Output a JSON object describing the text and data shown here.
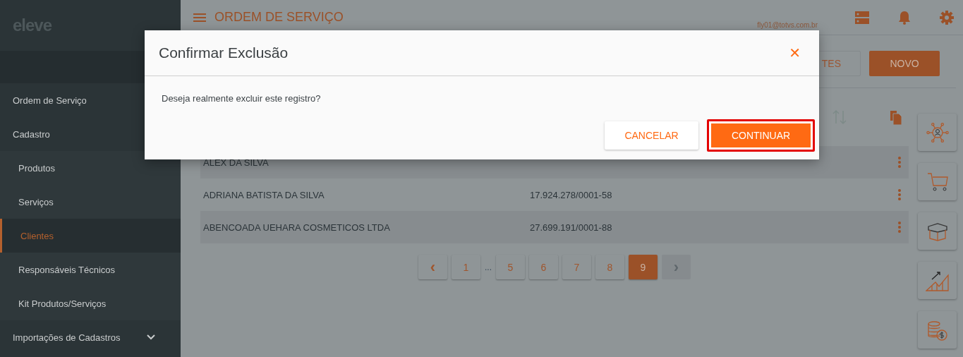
{
  "sidebar": {
    "logo": "eleve",
    "items": [
      {
        "label": "Ordem de Serviço",
        "kind": "section",
        "selected": false
      },
      {
        "label": "Cadastro",
        "kind": "section",
        "selected": false
      },
      {
        "label": "Produtos",
        "kind": "sub",
        "selected": false
      },
      {
        "label": "Serviços",
        "kind": "sub",
        "selected": false
      },
      {
        "label": "Clientes",
        "kind": "sub",
        "selected": true
      },
      {
        "label": "Responsáveis Técnicos",
        "kind": "sub",
        "selected": false
      },
      {
        "label": "Kit Produtos/Serviços",
        "kind": "sub",
        "selected": false
      },
      {
        "label": "Importações de Cadastros",
        "kind": "group",
        "selected": false
      }
    ]
  },
  "header": {
    "title": "ORDEM DE SERVIÇO",
    "user_email": "fly01@totvs.com.br"
  },
  "toolbar": [
    {
      "label": "TES",
      "kind": "outline"
    },
    {
      "label": "NOVO",
      "kind": "primary"
    }
  ],
  "table": {
    "rows": [
      {
        "column_1": "ALEX DA SILVA"
      },
      {
        "column_1": "ADRIANA BATISTA DA SILVA",
        "column_2": "17.924.278/0001-58"
      },
      {
        "column_1": "ABENCOADA UEHARA COSMETICOS LTDA",
        "column_2": "27.699.191/0001-88"
      }
    ]
  },
  "pagination": [
    {
      "kind": "prev",
      "label": "‹",
      "selected": false,
      "disabled": false
    },
    {
      "kind": "page",
      "label": "1",
      "selected": false,
      "disabled": false
    },
    {
      "kind": "ellipsis",
      "label": "..."
    },
    {
      "kind": "page",
      "label": "5",
      "selected": false,
      "disabled": false
    },
    {
      "kind": "page",
      "label": "6",
      "selected": false,
      "disabled": false
    },
    {
      "kind": "page",
      "label": "7",
      "selected": false,
      "disabled": false
    },
    {
      "kind": "page",
      "label": "8",
      "selected": false,
      "disabled": false
    },
    {
      "kind": "page",
      "label": "9",
      "selected": true,
      "disabled": false
    },
    {
      "kind": "next",
      "label": "›",
      "selected": false,
      "disabled": true
    }
  ],
  "shortcuts": [
    {
      "kind": "network"
    },
    {
      "kind": "cart"
    },
    {
      "kind": "box"
    },
    {
      "kind": "chart"
    },
    {
      "kind": "coins"
    }
  ],
  "modal": {
    "title": "Confirmar Exclusão",
    "message": "Deseja realmente excluir este registro?",
    "close": "✕",
    "buttons": [
      {
        "label": "CANCELAR",
        "kind": "secondary",
        "highlighted": false
      },
      {
        "label": "CONTINUAR",
        "kind": "primary",
        "highlighted": true
      }
    ]
  }
}
